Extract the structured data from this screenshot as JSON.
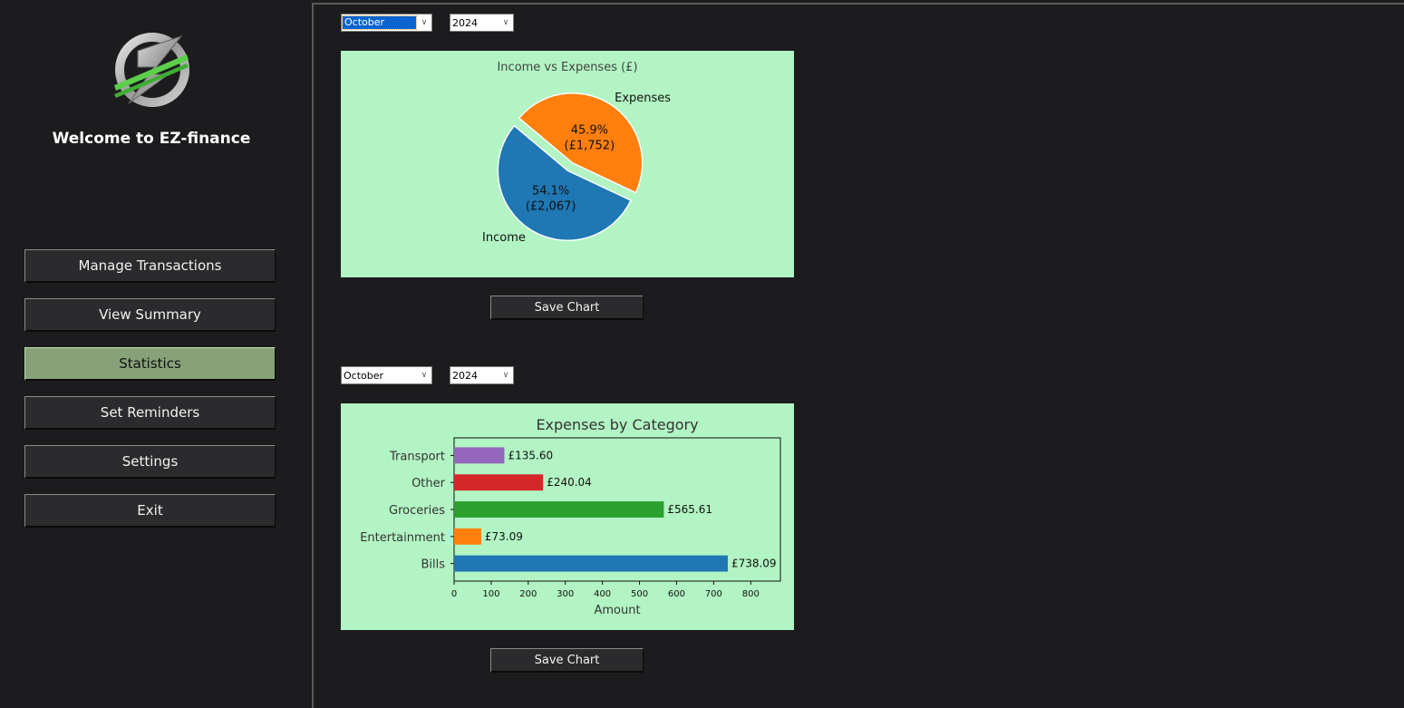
{
  "sidebar": {
    "welcome": "Welcome to EZ-finance",
    "logo_icon": "ez-logo",
    "nav": [
      {
        "label": "Manage Transactions",
        "active": false
      },
      {
        "label": "View Summary",
        "active": false
      },
      {
        "label": "Statistics",
        "active": true
      },
      {
        "label": "Set Reminders",
        "active": false
      },
      {
        "label": "Settings",
        "active": false
      },
      {
        "label": "Exit",
        "active": false
      }
    ]
  },
  "pie_section": {
    "month": "October",
    "year": "2024",
    "save_label": "Save Chart"
  },
  "bar_section": {
    "month": "October",
    "year": "2024",
    "save_label": "Save Chart"
  },
  "colors": {
    "chart_bg": "#b2f4c3",
    "active_nav": "#87a178"
  },
  "chart_data": [
    {
      "type": "pie",
      "title": "Income vs Expenses (£)",
      "slices": [
        {
          "label": "Income",
          "value": 2067,
          "percent": "54.1%",
          "amount_label": "(£2,067)",
          "color": "#1f77b4"
        },
        {
          "label": "Expenses",
          "value": 1752,
          "percent": "45.9%",
          "amount_label": "(£1,752)",
          "color": "#ff7f0e"
        }
      ]
    },
    {
      "type": "bar",
      "orientation": "horizontal",
      "title": "Expenses by Category",
      "xlabel": "Amount",
      "ylabel": "",
      "xlim": [
        0,
        880
      ],
      "xticks": [
        0,
        100,
        200,
        300,
        400,
        500,
        600,
        700,
        800
      ],
      "categories": [
        "Bills",
        "Entertainment",
        "Groceries",
        "Other",
        "Transport"
      ],
      "values": [
        738.09,
        73.09,
        565.61,
        240.04,
        135.6
      ],
      "value_labels": [
        "£738.09",
        "£73.09",
        "£565.61",
        "£240.04",
        "£135.60"
      ],
      "colors": [
        "#1f77b4",
        "#ff7f0e",
        "#2ca02c",
        "#d62728",
        "#9467bd"
      ],
      "grid": false
    }
  ]
}
